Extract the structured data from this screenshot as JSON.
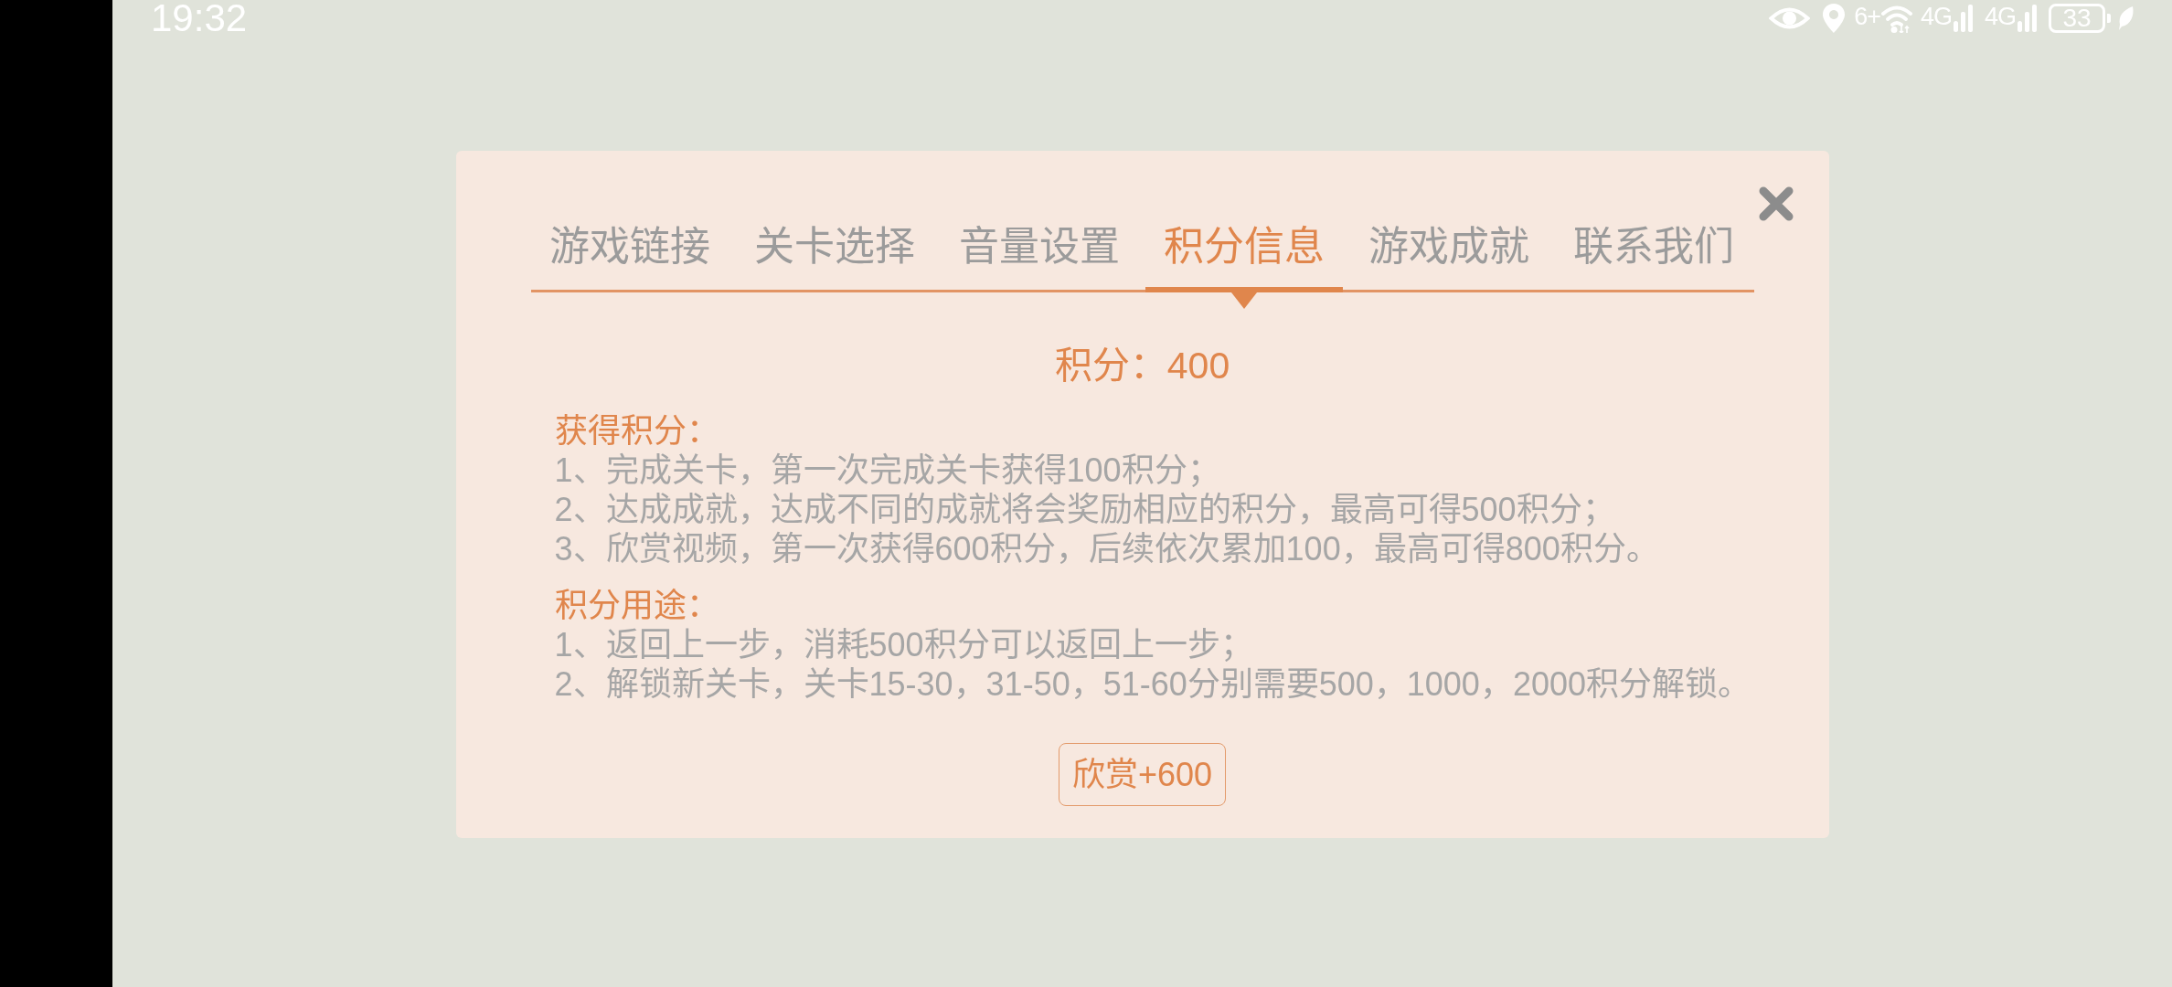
{
  "status_bar": {
    "time": "19:32",
    "wifi_badge": "6+",
    "signals": [
      {
        "label": "4G"
      },
      {
        "label": "4G"
      }
    ],
    "battery": "33"
  },
  "dialog": {
    "tabs": [
      {
        "label": "游戏链接",
        "selected": false
      },
      {
        "label": "关卡选择",
        "selected": false
      },
      {
        "label": "音量设置",
        "selected": false
      },
      {
        "label": "积分信息",
        "selected": true
      },
      {
        "label": "游戏成就",
        "selected": false
      },
      {
        "label": "联系我们",
        "selected": false
      }
    ],
    "score": "积分：400",
    "sections": [
      {
        "heading": "获得积分：",
        "items": [
          "1、完成关卡，第一次完成关卡获得100积分；",
          "2、达成成就，达成不同的成就将会奖励相应的积分，最高可得500积分；",
          "3、欣赏视频，第一次获得600积分，后续依次累加100，最高可得800积分。"
        ]
      },
      {
        "heading": "积分用途：",
        "items": [
          "1、返回上一步，消耗500积分可以返回上一步；",
          "2、解锁新关卡，关卡15-30，31-50，51-60分别需要500，1000，2000积分解锁。"
        ]
      }
    ],
    "button": "欣赏+600"
  }
}
